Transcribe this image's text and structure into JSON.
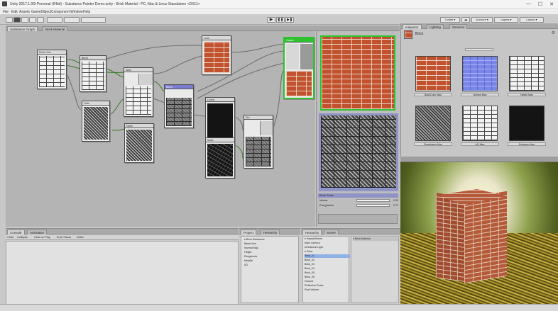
{
  "window": {
    "title": "Unity 2017.1.0f3 Personal (64bit) - Substance Painter Demo.unity - Brick Material - PC, Mac & Linux Standalone <DX11>",
    "controls": [
      "—",
      "☐",
      "✕"
    ]
  },
  "menu": [
    "File",
    "Edit",
    "Assets",
    "GameObject",
    "Component",
    "Window",
    "Help"
  ],
  "toolbar": {
    "play_icons": [
      "▶",
      "❚❚",
      "▶❚"
    ],
    "right_buttons": [
      "Collab ▾",
      "☁",
      "Account ▾",
      "Layers ▾",
      "Layout ▾"
    ]
  },
  "graph_tabs": [
    "Substance Graph",
    "Brick Material"
  ],
  "nodes": [
    {
      "id": "n1",
      "label": "Bricks Gen"
    },
    {
      "id": "n2",
      "label": "Blend"
    },
    {
      "id": "n3",
      "label": "Warp"
    },
    {
      "id": "n4",
      "label": "Cells"
    },
    {
      "id": "n5",
      "label": "Blend"
    },
    {
      "id": "n6",
      "label": "Noise"
    },
    {
      "id": "n7",
      "label": "Levels"
    },
    {
      "id": "n8",
      "label": "Color"
    },
    {
      "id": "n9",
      "label": "Output"
    },
    {
      "id": "n10",
      "label": "Mask"
    },
    {
      "id": "n11",
      "label": "Dirt"
    },
    {
      "id": "n12",
      "label": "Normal"
    }
  ],
  "preview_props": [
    {
      "label": "Brick Scale",
      "value": ""
    },
    {
      "label": "Mortar",
      "value": "0.35"
    },
    {
      "label": "Roughness",
      "value": "0.72"
    }
  ],
  "inspector": {
    "tabs": [
      "Inspector",
      "Lighting",
      "Services"
    ],
    "title": "Brick",
    "maps": [
      {
        "label": "BaseColor Map",
        "kind": "brick-red"
      },
      {
        "label": "Normal Map",
        "kind": "normal-blue"
      },
      {
        "label": "Height Map",
        "kind": "brick-white"
      },
      {
        "label": "Roughness Map",
        "kind": "noise"
      },
      {
        "label": "AO Map",
        "kind": "brick-white"
      },
      {
        "label": "Emission Map",
        "kind": "black"
      }
    ]
  },
  "bottom": {
    "console_tabs": [
      "Console",
      "Animation"
    ],
    "console_tools": [
      "Clear",
      "Collapse",
      "Clear on Play",
      "Error Pause",
      "Editor"
    ],
    "project_tabs": [
      "Project",
      "Hierarchy"
    ],
    "project_items": [
      "▾ Brick Substance",
      "  BaseColor",
      "  Normal Map",
      "  Height",
      "  Roughness",
      "  Metallic",
      "  AO"
    ],
    "tree_tabs": [
      "Hierarchy",
      "Scene"
    ],
    "tree_items": [
      "▾ SampleScene",
      "  Main Camera",
      "  Directional Light",
      "  ▾ Cube",
      "    Brick_01",
      "    Brick_02",
      "    Brick_03",
      "    Brick_04",
      "    Brick_05",
      "    Brick_06",
      "  Ground",
      "  Reflection Probe",
      "  Post Volume"
    ],
    "detail_header": "▾ Brick Material"
  }
}
